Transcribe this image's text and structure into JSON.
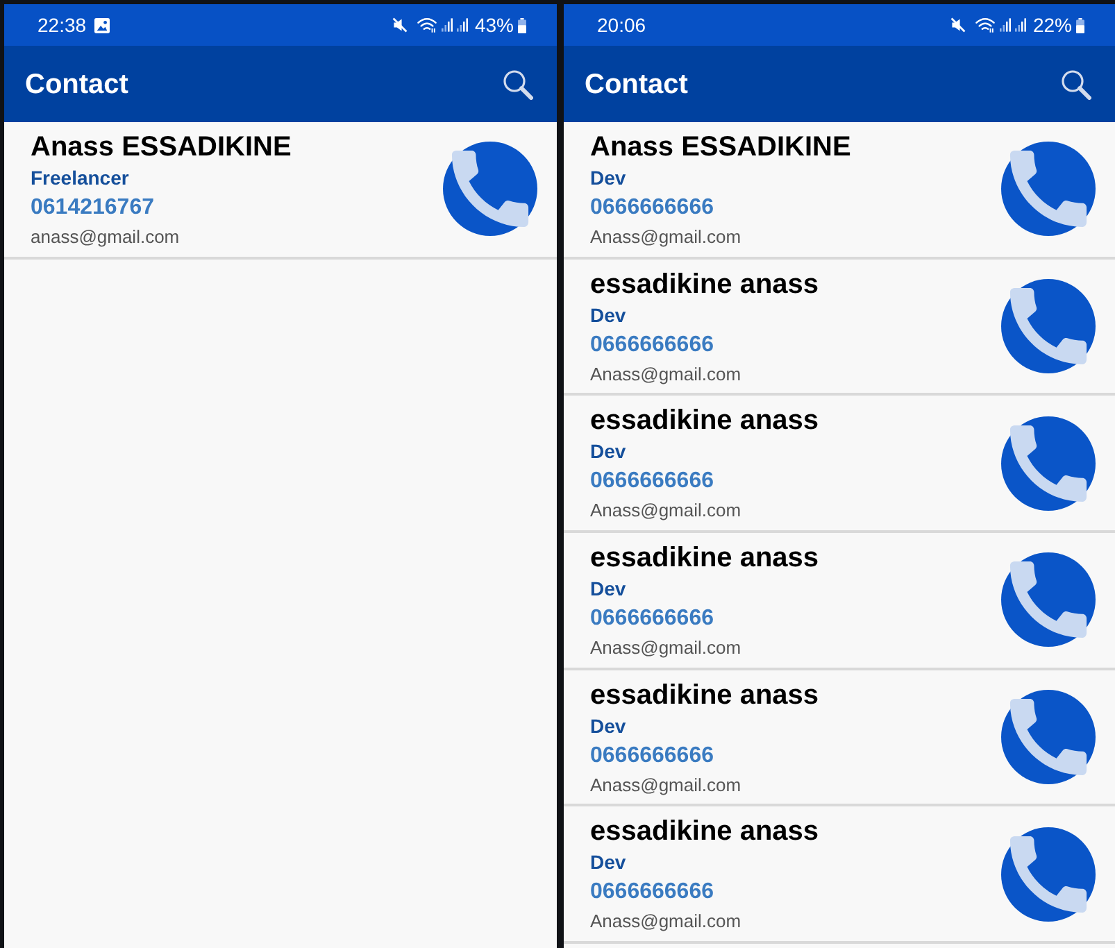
{
  "screens": [
    {
      "status_bar": {
        "time": "22:38",
        "notification_icons": [
          {
            "kind": "picture"
          }
        ],
        "battery": "43%"
      },
      "app_bar": {
        "title": "Contact"
      },
      "contacts": [
        {
          "name": "Anass ESSADIKINE",
          "role": "Freelancer",
          "phone": "0614216767",
          "email": "anass@gmail.com"
        }
      ]
    },
    {
      "status_bar": {
        "time": "20:06",
        "battery": "22%"
      },
      "app_bar": {
        "title": "Contact"
      },
      "contacts": [
        {
          "name": "Anass ESSADIKINE",
          "role": "Dev",
          "phone": "0666666666",
          "email": "Anass@gmail.com"
        },
        {
          "name": "essadikine anass",
          "role": "Dev",
          "phone": "0666666666",
          "email": "Anass@gmail.com"
        },
        {
          "name": "essadikine anass",
          "role": "Dev",
          "phone": "0666666666",
          "email": "Anass@gmail.com"
        },
        {
          "name": "essadikine anass",
          "role": "Dev",
          "phone": "0666666666",
          "email": "Anass@gmail.com"
        },
        {
          "name": "essadikine anass",
          "role": "Dev",
          "phone": "0666666666",
          "email": "Anass@gmail.com"
        },
        {
          "name": "essadikine anass",
          "role": "Dev",
          "phone": "0666666666",
          "email": "Anass@gmail.com"
        }
      ]
    }
  ]
}
